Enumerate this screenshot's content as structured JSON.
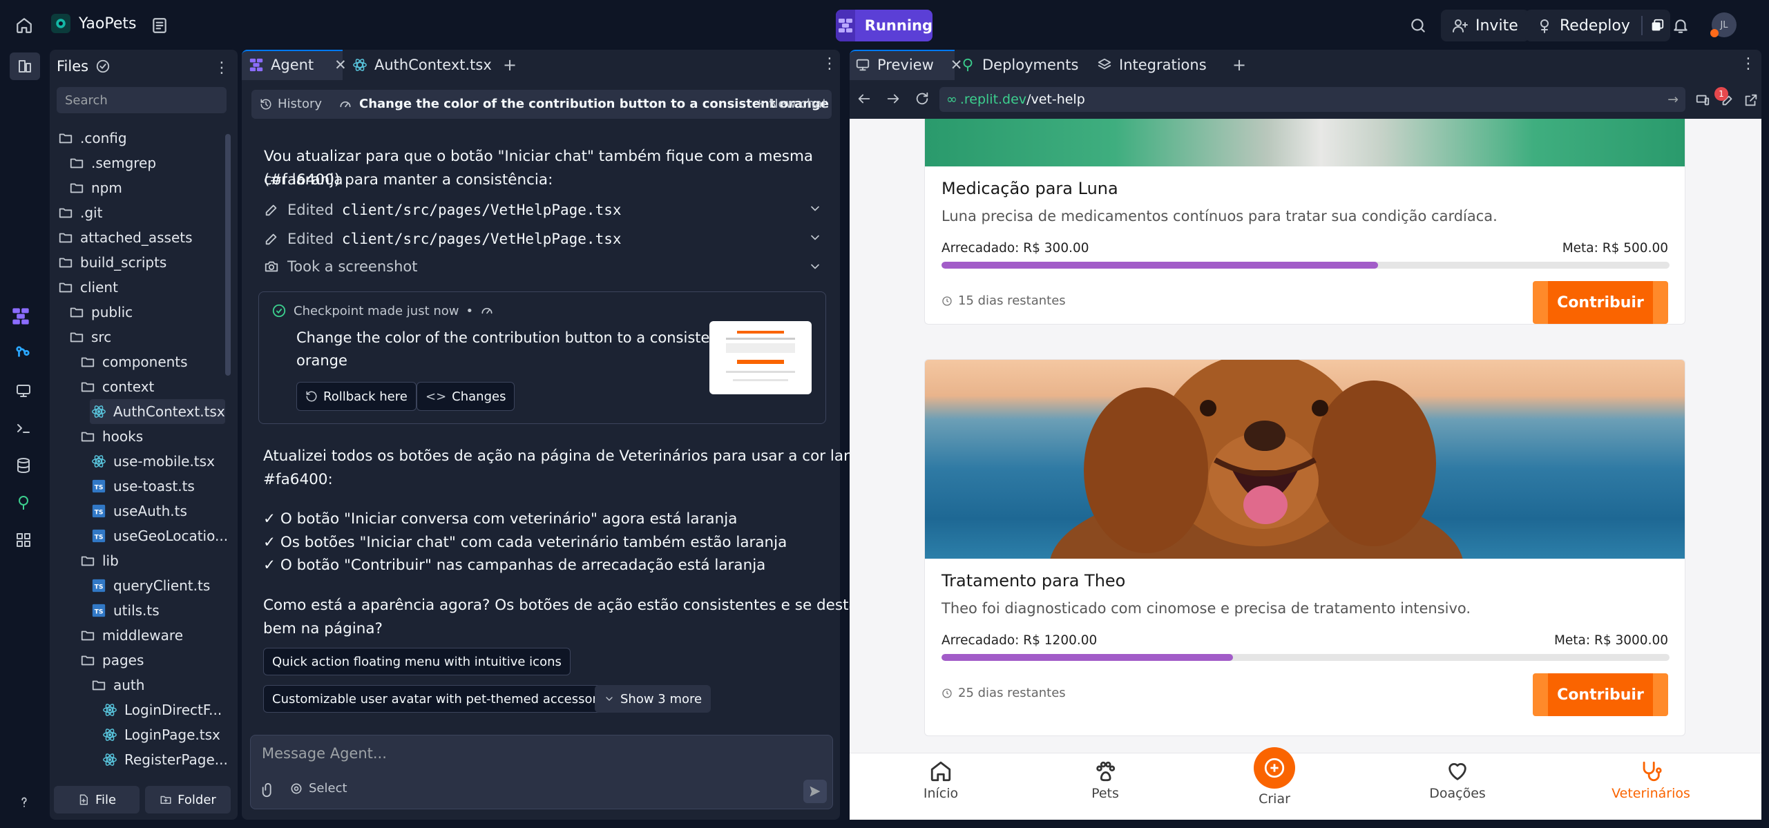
{
  "topbar": {
    "project_name": "YaoPets",
    "run_status": "Running",
    "invite_label": "Invite",
    "redeploy_label": "Redeploy",
    "avatar_initials": "JL"
  },
  "files": {
    "title": "Files",
    "search_placeholder": "Search",
    "tree": [
      {
        "name": ".config",
        "type": "folder"
      },
      {
        "name": ".semgrep",
        "type": "folder"
      },
      {
        "name": "npm",
        "type": "folder"
      },
      {
        "name": ".git",
        "type": "folder"
      },
      {
        "name": "attached_assets",
        "type": "folder"
      },
      {
        "name": "build_scripts",
        "type": "folder"
      },
      {
        "name": "client",
        "type": "folder"
      },
      {
        "name": "public",
        "type": "folder"
      },
      {
        "name": "src",
        "type": "folder"
      },
      {
        "name": "components",
        "type": "folder"
      },
      {
        "name": "context",
        "type": "folder"
      },
      {
        "name": "AuthContext.tsx",
        "type": "react"
      },
      {
        "name": "hooks",
        "type": "folder"
      },
      {
        "name": "use-mobile.tsx",
        "type": "react"
      },
      {
        "name": "use-toast.ts",
        "type": "ts"
      },
      {
        "name": "useAuth.ts",
        "type": "ts"
      },
      {
        "name": "useGeoLocatio...",
        "type": "ts"
      },
      {
        "name": "lib",
        "type": "folder"
      },
      {
        "name": "queryClient.ts",
        "type": "ts"
      },
      {
        "name": "utils.ts",
        "type": "ts"
      },
      {
        "name": "middleware",
        "type": "folder"
      },
      {
        "name": "pages",
        "type": "folder"
      },
      {
        "name": "auth",
        "type": "folder"
      },
      {
        "name": "LoginDirectF...",
        "type": "react"
      },
      {
        "name": "LoginPage.tsx",
        "type": "react"
      },
      {
        "name": "RegisterPage...",
        "type": "react"
      }
    ],
    "new_file_label": "File",
    "new_folder_label": "Folder"
  },
  "agent": {
    "tabs": [
      "Agent",
      "AuthContext.tsx"
    ],
    "history_label": "History",
    "chat_title": "Change the color of the contribution button to a consistent orange",
    "new_chat_label": "New chat",
    "intro_line1": "Vou atualizar para que o botão \"Iniciar chat\" também fique com a mesma cor laranja",
    "intro_line2": "(#fa6400) para manter a consistência:",
    "actions": [
      {
        "verb": "Edited",
        "path": "client/src/pages/VetHelpPage.tsx"
      },
      {
        "verb": "Edited",
        "path": "client/src/pages/VetHelpPage.tsx"
      },
      {
        "verb": "Took a screenshot",
        "path": ""
      }
    ],
    "checkpoint": {
      "label": "Checkpoint made just now",
      "dot": "•",
      "title_line1": "Change the color of the contribution button to a consistent",
      "title_line2": "orange",
      "rollback_label": "Rollback here",
      "changes_label": "Changes"
    },
    "summary_line1": "Atualizei todos os botões de ação na página de Veterinários para usar a cor laranja",
    "summary_line2": "#fa6400:",
    "bullets": [
      "✓ O botão \"Iniciar conversa com veterinário\" agora está laranja",
      "✓ Os botões \"Iniciar chat\" com cada veterinário também estão laranja",
      "✓ O botão \"Contribuir\" nas campanhas de arrecadação está laranja"
    ],
    "question_line1": "Como está a aparência agora? Os botões de ação estão consistentes e se destacam",
    "question_line2": "bem na página?",
    "suggestions": [
      "Quick action floating menu with intuitive icons",
      "Customizable user avatar with pet-themed accessories"
    ],
    "show_more_label": "Show 3 more",
    "input_placeholder": "Message Agent...",
    "select_label": "Select"
  },
  "preview": {
    "tabs": [
      "Preview",
      "Deployments",
      "Integrations"
    ],
    "url_host": ".replit.dev",
    "url_path": "/vet-help",
    "notification_count": "1",
    "campaigns": [
      {
        "title": "Medicação para Luna",
        "description": "Luna precisa de medicamentos contínuos para tratar sua condição cardíaca.",
        "raised": "Arrecadado: R$ 300.00",
        "goal": "Meta: R$ 500.00",
        "progress": 0.6,
        "days_left": "15 dias restantes",
        "button": "Contribuir"
      },
      {
        "title": "Tratamento para Theo",
        "description": "Theo foi diagnosticado com cinomose e precisa de tratamento intensivo.",
        "raised": "Arrecadado: R$ 1200.00",
        "goal": "Meta: R$ 3000.00",
        "progress": 0.4,
        "days_left": "25 dias restantes",
        "button": "Contribuir"
      }
    ],
    "bottom_nav": [
      "Início",
      "Pets",
      "Criar",
      "Doações",
      "Veterinários"
    ],
    "accent_color": "#fa6400",
    "progress_color": "#a25cc8"
  }
}
